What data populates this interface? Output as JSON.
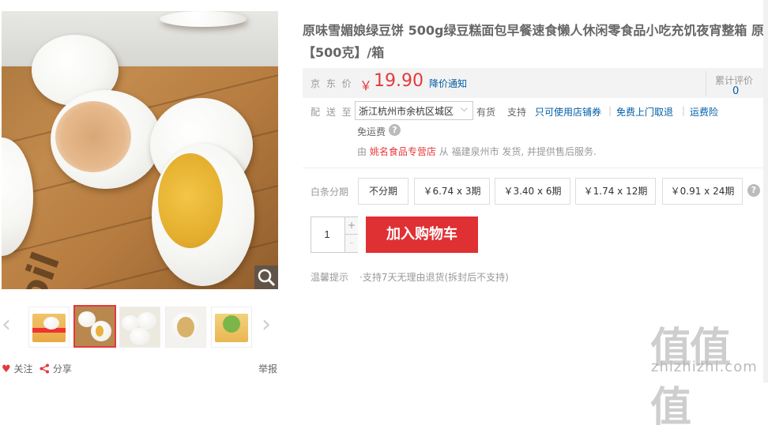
{
  "product": {
    "title_line1": "原味雪媚娘绿豆饼 500g绿豆糕面包早餐速食懒人休闲零食品小吃充饥夜宵整箱 原味",
    "title_line2": "【500克】/箱"
  },
  "price": {
    "label": "京 东 价",
    "currency": "￥",
    "value": "19.90",
    "notify_link": "降价通知",
    "review_label": "累计评价",
    "review_count": "0"
  },
  "delivery": {
    "label": "配 送 至",
    "location": "浙江杭州市余杭区城区",
    "stock": "有货",
    "support_label": "支持",
    "services": [
      "只可使用店铺券",
      "免费上门取退",
      "运费险"
    ],
    "free_shipping": "免运费",
    "from_prefix": "由",
    "store_name": "姚名食品专营店",
    "from_suffix": "从 福建泉州市 发货, 并提供售后服务."
  },
  "installment": {
    "label": "白条分期",
    "options": [
      "不分期",
      "￥6.74 x 3期",
      "￥3.40 x 6期",
      "￥1.74 x 12期",
      "￥0.91 x 24期"
    ]
  },
  "purchase": {
    "quantity": "1",
    "plus": "+",
    "minus": "-",
    "add_to_cart": "加入购物车"
  },
  "tips": {
    "label": "温馨提示",
    "text": "·支持7天无理由退货(拆封后不支持)"
  },
  "gallery": {
    "prev": "‹",
    "next": "›",
    "thumb_count": 5,
    "selected_index": 1
  },
  "footer": {
    "follow": "关注",
    "share": "分享",
    "report": "举报"
  },
  "watermark": {
    "logo": "值值值",
    "site": "zhizhizhi.com"
  },
  "colors": {
    "accent_red": "#e4393c",
    "link_blue": "#005ea7",
    "cart_red": "#df3033"
  },
  "icons": [
    "zoom-icon",
    "heart-icon",
    "share-icon",
    "question-icon",
    "chevron-down-icon",
    "arrow-left-icon",
    "arrow-right-icon"
  ]
}
